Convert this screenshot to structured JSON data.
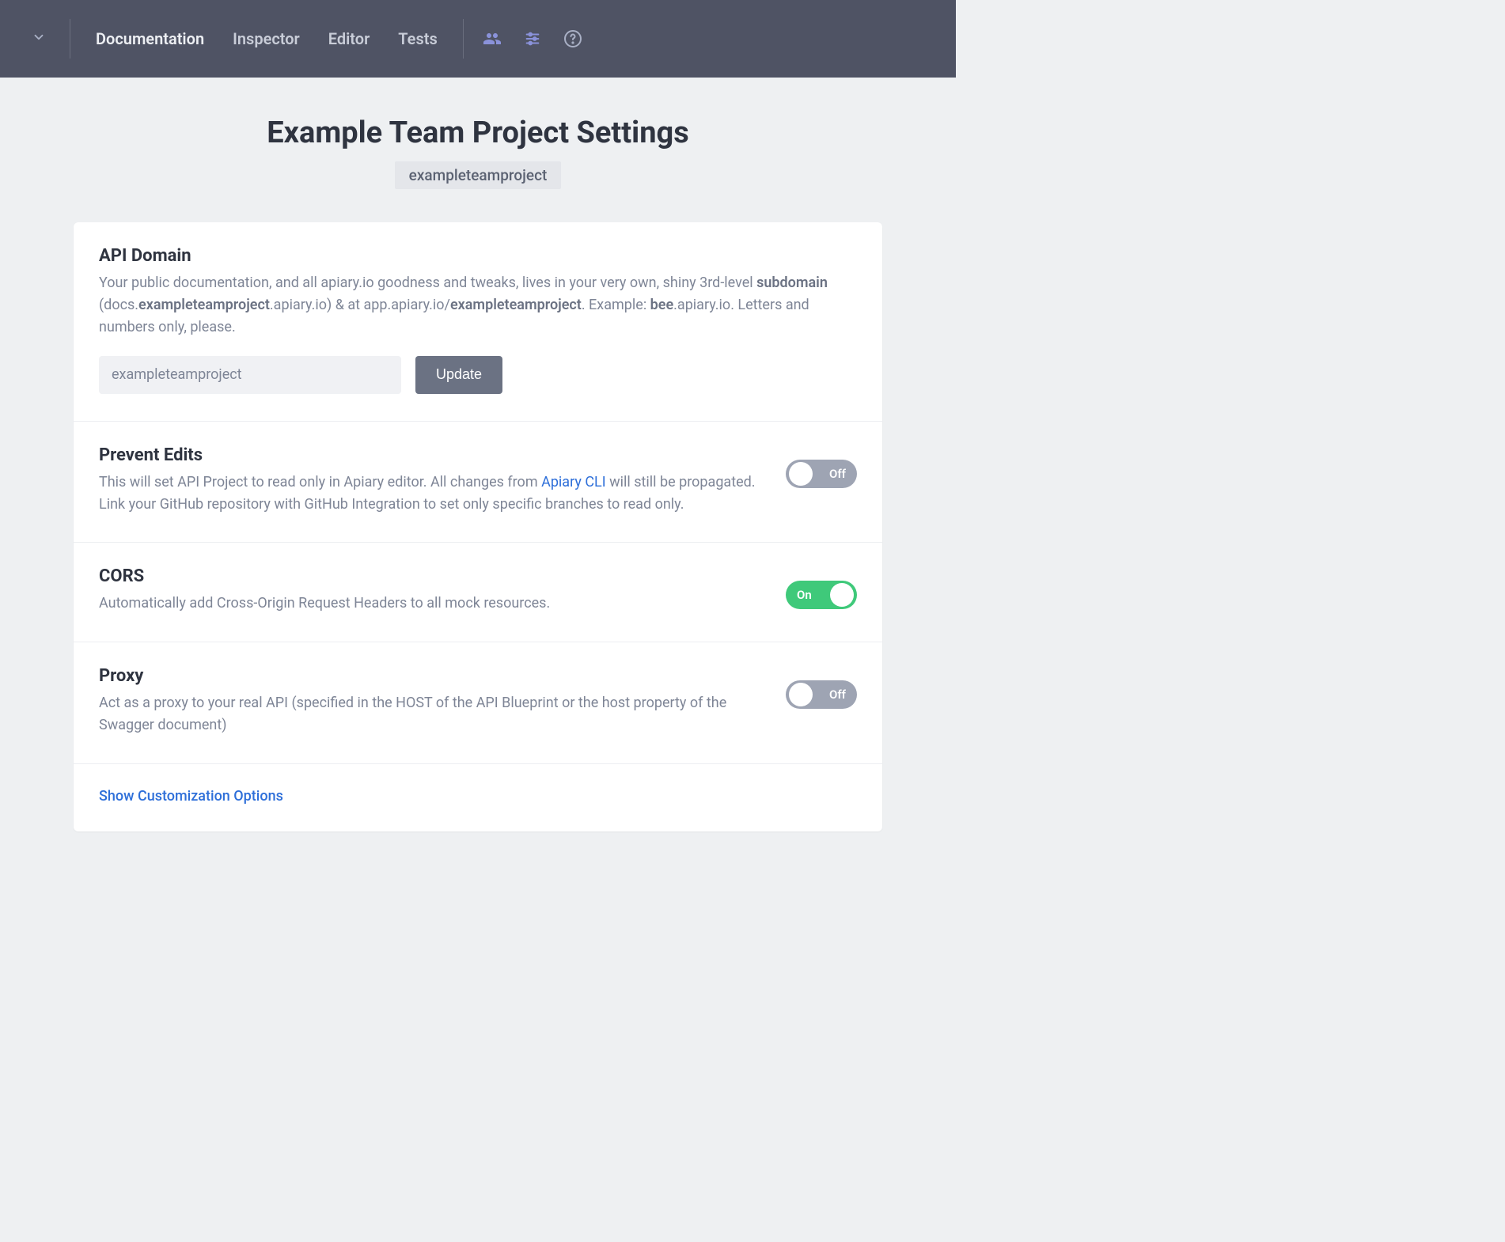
{
  "nav": {
    "items": [
      "Documentation",
      "Inspector",
      "Editor",
      "Tests"
    ]
  },
  "header": {
    "title": "Example Team Project Settings",
    "slug": "exampleteamproject"
  },
  "sections": {
    "apiDomain": {
      "title": "API Domain",
      "desc_pre": "Your public documentation, and all apiary.io goodness and tweaks, lives in your very own, shiny 3rd-level ",
      "desc_bold1": "subdomain",
      "desc_mid1": " (docs.",
      "desc_bold2": "exampleteamproject",
      "desc_mid2": ".apiary.io) & at app.apiary.io/",
      "desc_bold3": "exampleteamproject",
      "desc_mid3": ". Example: ",
      "desc_bold4": "bee",
      "desc_post": ".apiary.io. Letters and numbers only, please.",
      "input_value": "exampleteamproject",
      "update_label": "Update"
    },
    "preventEdits": {
      "title": "Prevent Edits",
      "desc_pre": "This will set API Project to read only in Apiary editor. All changes from ",
      "link_text": "Apiary CLI",
      "desc_post": " will still be propagated. Link your GitHub repository with GitHub Integration to set only specific branches to read only.",
      "toggle_state": "off",
      "toggle_label": "Off"
    },
    "cors": {
      "title": "CORS",
      "desc": "Automatically add Cross-Origin Request Headers to all mock resources.",
      "toggle_state": "on",
      "toggle_label": "On"
    },
    "proxy": {
      "title": "Proxy",
      "desc": "Act as a proxy to your real API (specified in the HOST of the API Blueprint or the host property of the Swagger document)",
      "toggle_state": "off",
      "toggle_label": "Off"
    },
    "customization": {
      "link": "Show Customization Options"
    }
  }
}
